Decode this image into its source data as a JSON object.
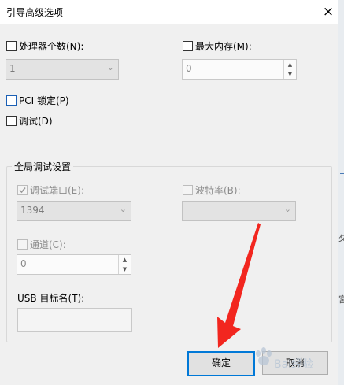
{
  "window": {
    "title": "引导高级选项",
    "close_glyph": "×"
  },
  "processors": {
    "label": "处理器个数(N):",
    "checked": false,
    "value": "1",
    "arrow": "⌄"
  },
  "max_memory": {
    "label": "最大内存(M):",
    "checked": false,
    "value": "0"
  },
  "pci_lock": {
    "label": "PCI 锁定(P)",
    "checked": false
  },
  "debug": {
    "label": "调试(D)",
    "checked": false
  },
  "global_debug": {
    "title": "全局调试设置",
    "debug_port": {
      "label": "调试端口(E):",
      "checked": true,
      "enabled": false,
      "value": "1394",
      "arrow": "⌄"
    },
    "baud_rate": {
      "label": "波特率(B):",
      "checked": false,
      "enabled": false,
      "value": "",
      "arrow": "⌄"
    },
    "channel": {
      "label": "通道(C):",
      "checked": false,
      "enabled": false,
      "value": "0"
    },
    "usb_target": {
      "label": "USB 目标名(T):",
      "value": ""
    }
  },
  "buttons": {
    "ok": "确定",
    "cancel": "取消"
  },
  "spin_glyphs": {
    "up": "▲",
    "down": "▼"
  },
  "overlay": {
    "arrow_color": "#f2261f",
    "watermark": "Bai经验"
  },
  "background_chars": [
    "夂",
    "宮"
  ]
}
